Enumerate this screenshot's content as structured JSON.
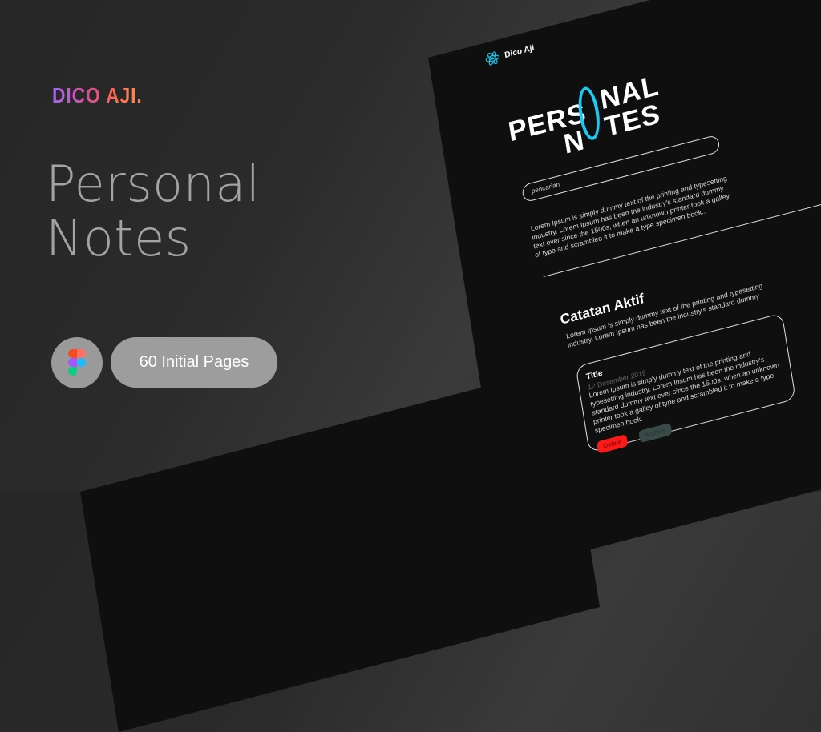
{
  "promo": {
    "brand": "DICO AJI.",
    "title_line1": "Personal",
    "title_line2": "Notes",
    "badge_icon": "figma-icon",
    "pages_label": "60 Initial Pages"
  },
  "mockup": {
    "logo_icon": "react-icon",
    "logo_text": "Dico Aji",
    "hero": {
      "part1": "PERS",
      "part2": "NAL",
      "part3": "N",
      "part4": "TES",
      "accent": "#1ec8ee"
    },
    "search_placeholder": "pencarian",
    "intro": "Lorem Ipsum is simply dummy text of the printing and typesetting industry. Lorem Ipsum has been the industry's standard dummy text ever since the 1500s, when an unknown printer took a galley of type and scrambled it to make a type specimen book..",
    "section_title": "Catatan Aktif",
    "section_desc": "Lorem Ipsum is simply dummy text of the printing and typesetting industry. Lorem Ipsum has been the industry's standard dummy",
    "note": {
      "title": "Title",
      "date": "12 Desember 2019",
      "body": "Lorem Ipsum is simply dummy text of the printing and typesetting industry. Lorem Ipsum has been the industry's standard dummy text ever since the 1500s, when an unknown printer took a galley of type and scrambled it to make a type specimen book..",
      "delete_label": "Delete",
      "archive_label": "Archive",
      "delete_color": "#ff1a1a",
      "archive_color": "#3a4a47"
    }
  }
}
